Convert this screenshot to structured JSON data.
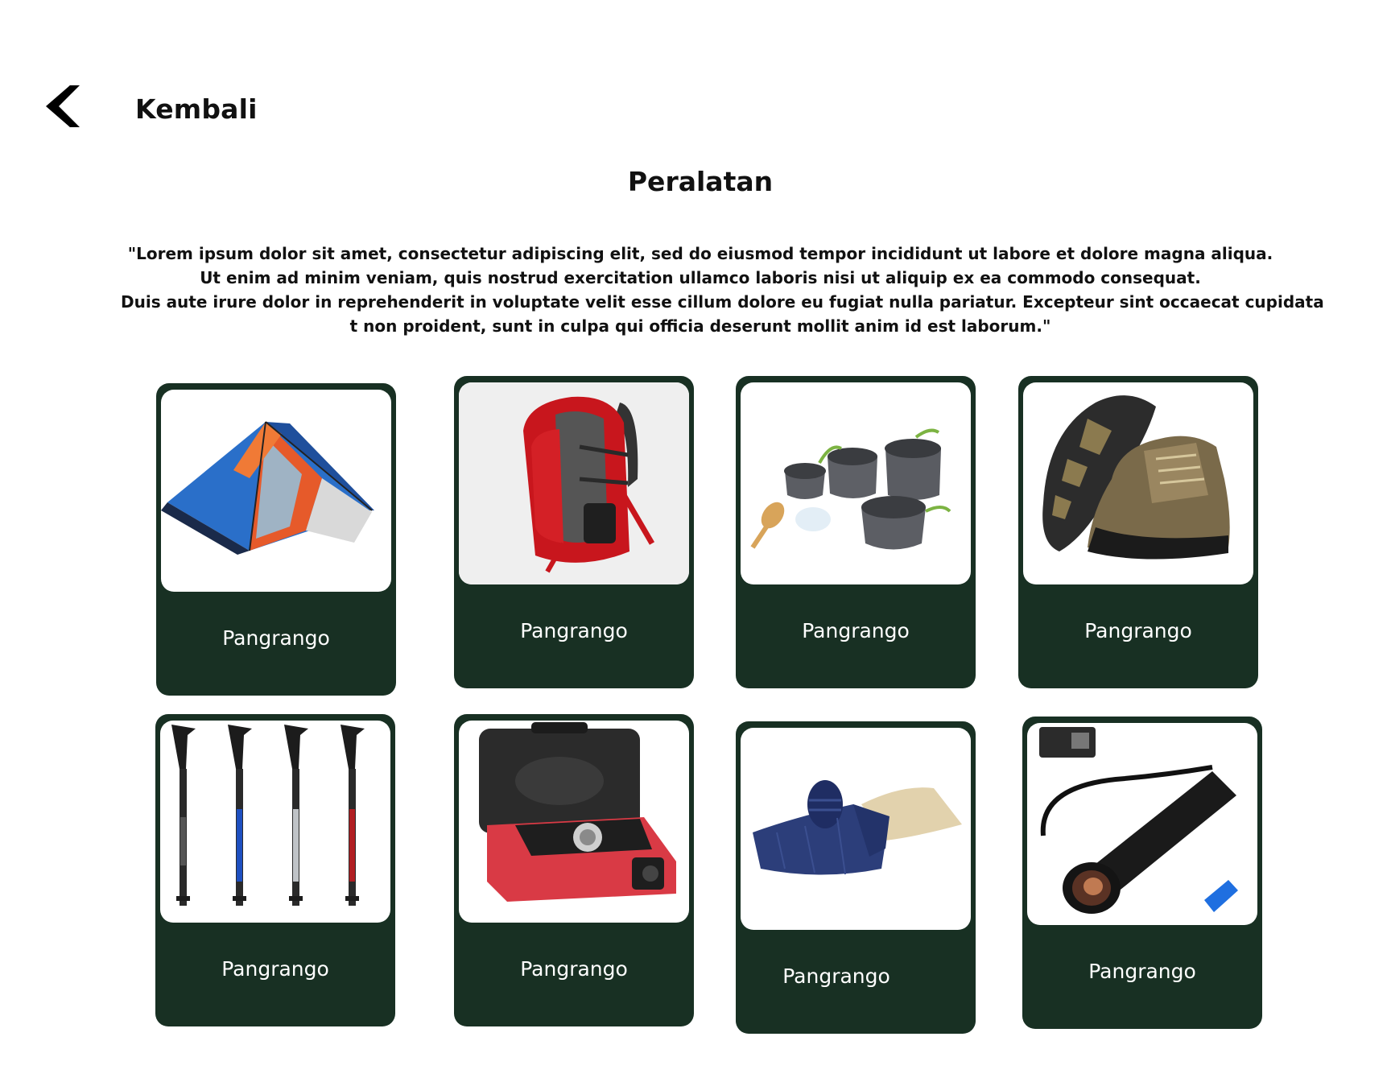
{
  "nav": {
    "back_label": "Kembali",
    "back_icon": "chevron-left-icon"
  },
  "page": {
    "title": "Peralatan",
    "intro_lines": [
      "\"Lorem ipsum dolor sit amet, consectetur adipiscing elit, sed do eiusmod tempor incididunt ut labore et dolore magna aliqua.",
      "Ut enim ad minim veniam, quis nostrud exercitation ullamco laboris nisi ut aliquip ex ea commodo consequat.",
      "Duis aute irure dolor in reprehenderit in voluptate velit esse cillum dolore eu fugiat nulla pariatur. Excepteur sint occaecat cupidata",
      "t non proident, sunt in culpa qui officia deserunt mollit anim id est laborum.\""
    ]
  },
  "items": [
    {
      "label": "Pangrango",
      "image": "tent-image"
    },
    {
      "label": "Pangrango",
      "image": "backpack-image"
    },
    {
      "label": "Pangrango",
      "image": "cookware-set-image"
    },
    {
      "label": "Pangrango",
      "image": "hiking-boots-image"
    },
    {
      "label": "Pangrango",
      "image": "trekking-poles-image"
    },
    {
      "label": "Pangrango",
      "image": "portable-stove-image"
    },
    {
      "label": "Pangrango",
      "image": "sleeping-bag-image"
    },
    {
      "label": "Pangrango",
      "image": "flashlight-image"
    }
  ],
  "colors": {
    "card_bg": "#183023",
    "card_label": "#ffffff",
    "text": "#111111",
    "page_bg": "#ffffff"
  }
}
